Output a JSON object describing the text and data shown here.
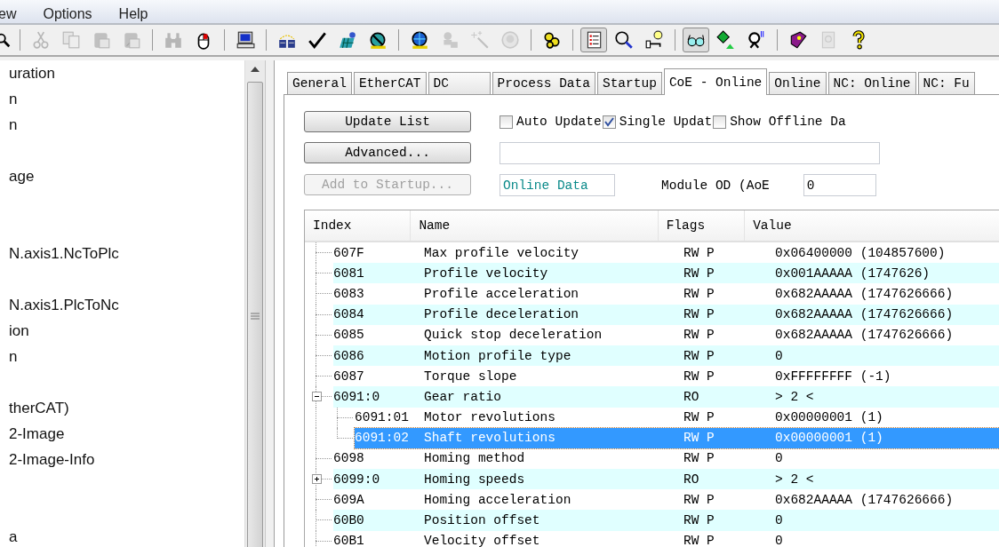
{
  "menu": {
    "items": [
      "ew",
      "Options",
      "Help"
    ]
  },
  "toolbar": {
    "buttons": [
      {
        "disabled": false,
        "pressed": false
      },
      {
        "disabled": true,
        "pressed": false
      },
      {
        "disabled": true,
        "pressed": false
      },
      {
        "disabled": true,
        "pressed": false
      },
      {
        "disabled": true,
        "pressed": false
      },
      {
        "disabled": true,
        "pressed": false
      },
      {
        "disabled": false,
        "pressed": false
      },
      {
        "disabled": false,
        "pressed": false
      },
      {
        "disabled": false,
        "pressed": false
      },
      {
        "disabled": false,
        "pressed": false
      },
      {
        "disabled": false,
        "pressed": false
      },
      {
        "disabled": false,
        "pressed": false
      },
      {
        "disabled": false,
        "pressed": false
      },
      {
        "disabled": true,
        "pressed": false
      },
      {
        "disabled": true,
        "pressed": false
      },
      {
        "disabled": true,
        "pressed": false
      },
      {
        "disabled": false,
        "pressed": false
      },
      {
        "disabled": false,
        "pressed": true
      },
      {
        "disabled": false,
        "pressed": false
      },
      {
        "disabled": false,
        "pressed": false
      },
      {
        "disabled": false,
        "pressed": true
      },
      {
        "disabled": false,
        "pressed": false
      },
      {
        "disabled": false,
        "pressed": false
      },
      {
        "disabled": false,
        "pressed": false
      },
      {
        "disabled": true,
        "pressed": false
      },
      {
        "disabled": false,
        "pressed": false
      }
    ]
  },
  "sidebar": {
    "items": [
      "uration",
      "n",
      "n",
      "age",
      "N.axis1.NcToPlc",
      "N.axis1.PlcToNc",
      "ion",
      "n",
      "therCAT)",
      "2-Image",
      "2-Image-Info",
      "a"
    ]
  },
  "tabs": [
    {
      "label": "General",
      "selected": false
    },
    {
      "label": "EtherCAT",
      "selected": false
    },
    {
      "label": "DC",
      "selected": false
    },
    {
      "label": "Process Data",
      "selected": false
    },
    {
      "label": "Startup",
      "selected": false
    },
    {
      "label": "CoE - Online",
      "selected": true
    },
    {
      "label": "Online",
      "selected": false
    },
    {
      "label": "NC: Online",
      "selected": false
    },
    {
      "label": "NC: Fu",
      "selected": false
    }
  ],
  "buttons": [
    {
      "label": "Update List",
      "disabled": false
    },
    {
      "label": "Advanced...",
      "disabled": false
    },
    {
      "label": "Add to Startup...",
      "disabled": true
    }
  ],
  "checkboxes": [
    {
      "label": "Auto Update",
      "checked": false
    },
    {
      "label": "Single Updat",
      "checked": true
    },
    {
      "label": "Show Offline Da",
      "checked": false
    }
  ],
  "online_data": {
    "value": "Online Data"
  },
  "module_od": {
    "label": "Module OD (AoE",
    "value": "0"
  },
  "table": {
    "columns": [
      "Index",
      "Name",
      "Flags",
      "Value"
    ],
    "rows": [
      {
        "index": "607F",
        "name": "Max profile velocity",
        "flags": "RW P",
        "value": "0x06400000 (104857600)",
        "selected": false
      },
      {
        "index": "6081",
        "name": "Profile velocity",
        "flags": "RW P",
        "value": "0x001AAAAA (1747626)",
        "selected": false
      },
      {
        "index": "6083",
        "name": "Profile acceleration",
        "flags": "RW P",
        "value": "0x682AAAAA (1747626666)",
        "selected": false
      },
      {
        "index": "6084",
        "name": "Profile deceleration",
        "flags": "RW P",
        "value": "0x682AAAAA (1747626666)",
        "selected": false
      },
      {
        "index": "6085",
        "name": "Quick stop deceleration",
        "flags": "RW P",
        "value": "0x682AAAAA (1747626666)",
        "selected": false
      },
      {
        "index": "6086",
        "name": "Motion profile type",
        "flags": "RW P",
        "value": "0",
        "selected": false
      },
      {
        "index": "6087",
        "name": "Torque slope",
        "flags": "RW P",
        "value": "0xFFFFFFFF (-1)",
        "selected": false
      },
      {
        "index": "6091:0",
        "name": "Gear ratio",
        "flags": "RO",
        "value": "> 2 <",
        "selected": false,
        "expanded": true,
        "children": [
          {
            "index": "6091:01",
            "name": "Motor revolutions",
            "flags": "RW P",
            "value": "0x00000001 (1)",
            "selected": false
          },
          {
            "index": "6091:02",
            "name": "Shaft revolutions",
            "flags": "RW P",
            "value": "0x00000001 (1)",
            "selected": true
          }
        ]
      },
      {
        "index": "6098",
        "name": "Homing method",
        "flags": "RW P",
        "value": "0",
        "selected": false
      },
      {
        "index": "6099:0",
        "name": "Homing speeds",
        "flags": "RO",
        "value": "> 2 <",
        "selected": false,
        "expanded": false
      },
      {
        "index": "609A",
        "name": "Homing acceleration",
        "flags": "RW P",
        "value": "0x682AAAAA (1747626666)",
        "selected": false
      },
      {
        "index": "60B0",
        "name": "Position offset",
        "flags": "RW P",
        "value": "0",
        "selected": false
      },
      {
        "index": "60B1",
        "name": "Velocity offset",
        "flags": "RW P",
        "value": "0",
        "selected": false
      }
    ]
  }
}
